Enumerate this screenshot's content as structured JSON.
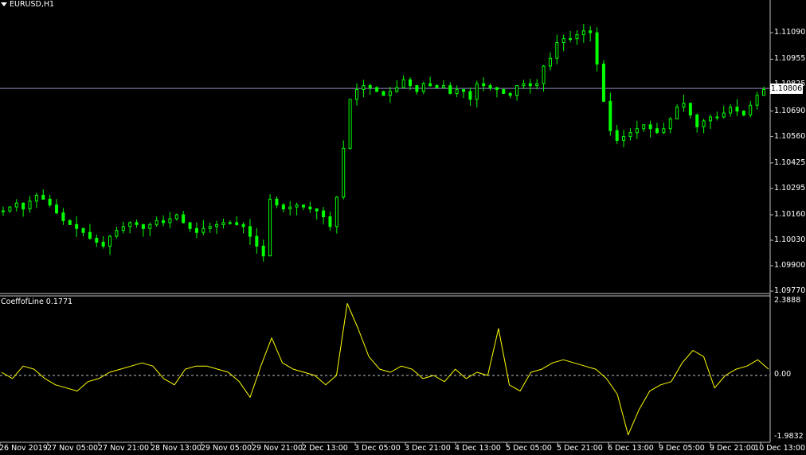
{
  "symbol": "EURUSD,H1",
  "indicator": {
    "label": "CoeffofLine 0.1771",
    "ymax_label": "2.3888",
    "zero_label": "0.00",
    "ymin_label": "-1.9832"
  },
  "price_axis": [
    "1.11090",
    "1.10955",
    "1.10825",
    "1.10690",
    "1.10560",
    "1.10425",
    "1.10295",
    "1.10160",
    "1.10030",
    "1.09900",
    "1.09770"
  ],
  "current_price": "1.10806",
  "time_axis": [
    "26 Nov 2019",
    "27 Nov 05:00",
    "27 Nov 21:00",
    "28 Nov 13:00",
    "29 Nov 05:00",
    "29 Nov 21:00",
    "2 Dec 13:00",
    "3 Dec 05:00",
    "3 Dec 21:00",
    "4 Dec 13:00",
    "5 Dec 05:00",
    "5 Dec 21:00",
    "6 Dec 13:00",
    "9 Dec 05:00",
    "9 Dec 21:00",
    "10 Dec 13:00"
  ],
  "colors": {
    "candle": "#00ff00",
    "indicator": "#ffff00",
    "border": "#c0c0c0",
    "price_line": "#8a8ab8",
    "zero_line": "#c0c0c0"
  },
  "chart_data": {
    "type": "line",
    "title": "EURUSD,H1",
    "price_closes": [
      1.1018,
      1.102,
      1.1022,
      1.1019,
      1.1023,
      1.1026,
      1.1024,
      1.1021,
      1.1017,
      1.1013,
      1.1011,
      1.1009,
      1.1007,
      1.1004,
      1.1002,
      1.1,
      1.1005,
      1.1008,
      1.101,
      1.1012,
      1.1011,
      1.1009,
      1.1011,
      1.1013,
      1.1012,
      1.1014,
      1.1016,
      1.1012,
      1.1009,
      1.1007,
      1.1009,
      1.101,
      1.1011,
      1.1012,
      1.1012,
      1.1011,
      1.101,
      1.1005,
      1.1,
      1.0995,
      1.1024,
      1.1021,
      1.1019,
      1.102,
      1.1021,
      1.102,
      1.1019,
      1.1018,
      1.1015,
      1.101,
      1.1025,
      1.105,
      1.1075,
      1.108,
      1.1082,
      1.1081,
      1.1079,
      1.1077,
      1.1079,
      1.1081,
      1.1085,
      1.1082,
      1.1079,
      1.1083,
      1.1082,
      1.1081,
      1.1082,
      1.1078,
      1.108,
      1.1079,
      1.1075,
      1.1083,
      1.1082,
      1.1081,
      1.108,
      1.1078,
      1.1077,
      1.1082,
      1.1083,
      1.1082,
      1.1083,
      1.1092,
      1.1096,
      1.1104,
      1.1106,
      1.1106,
      1.1108,
      1.111,
      1.1109,
      1.1093,
      1.1074,
      1.1059,
      1.1054,
      1.1056,
      1.1058,
      1.106,
      1.1062,
      1.106,
      1.1058,
      1.106,
      1.1065,
      1.1071,
      1.1073,
      1.1067,
      1.1061,
      1.1064,
      1.1066,
      1.1066,
      1.1068,
      1.1071,
      1.1069,
      1.1067,
      1.1072,
      1.1077,
      1.108
    ],
    "indicator_values": [
      0.1,
      -0.1,
      0.3,
      0.2,
      -0.1,
      -0.3,
      -0.4,
      -0.5,
      -0.2,
      -0.1,
      0.1,
      0.2,
      0.3,
      0.4,
      0.3,
      -0.1,
      -0.3,
      0.2,
      0.3,
      0.3,
      0.2,
      0.1,
      -0.2,
      -0.7,
      0.3,
      1.2,
      0.4,
      0.2,
      0.1,
      0.0,
      -0.3,
      0.0,
      2.3,
      1.5,
      0.6,
      0.2,
      0.1,
      0.3,
      0.2,
      -0.1,
      0.0,
      -0.2,
      0.2,
      -0.1,
      0.1,
      0.0,
      1.5,
      -0.3,
      -0.5,
      0.1,
      0.2,
      0.4,
      0.5,
      0.4,
      0.3,
      0.2,
      -0.1,
      -0.6,
      -1.9,
      -1.1,
      -0.5,
      -0.3,
      -0.2,
      0.4,
      0.8,
      0.6,
      -0.4,
      0.0,
      0.2,
      0.3,
      0.5,
      0.2
    ],
    "price_ylim": [
      1.0977,
      1.11225
    ],
    "indicator_ylim": [
      -1.9832,
      2.3888
    ]
  }
}
